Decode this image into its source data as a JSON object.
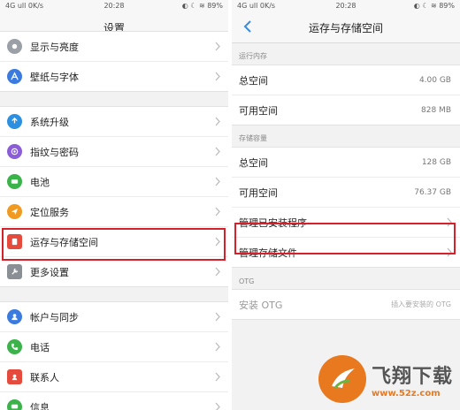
{
  "left": {
    "status": {
      "signal": "4G  ull  0K/s",
      "time": "20:28",
      "right": "◐ ☾ ≋ 89%"
    },
    "title": "设置",
    "groups": [
      {
        "items": [
          {
            "label": "显示与亮度",
            "icon": "sun-icon",
            "color": "#9aa0a6"
          },
          {
            "label": "壁纸与字体",
            "icon": "font-icon",
            "color": "#3b7be0"
          }
        ]
      },
      {
        "items": [
          {
            "label": "系统升级",
            "icon": "update-icon",
            "color": "#2d8fe0"
          },
          {
            "label": "指纹与密码",
            "icon": "fingerprint-icon",
            "color": "#8b5dd6"
          },
          {
            "label": "电池",
            "icon": "battery-icon",
            "color": "#3bb34a"
          },
          {
            "label": "定位服务",
            "icon": "location-icon",
            "color": "#f09a22"
          },
          {
            "label": "运存与存储空间",
            "icon": "storage-icon",
            "color": "#e44b3c"
          },
          {
            "label": "更多设置",
            "icon": "wrench-icon",
            "color": "#8a8f96"
          }
        ]
      },
      {
        "items": [
          {
            "label": "帐户与同步",
            "icon": "account-icon",
            "color": "#3b7be0"
          },
          {
            "label": "电话",
            "icon": "phone-icon",
            "color": "#3bb34a"
          },
          {
            "label": "联系人",
            "icon": "contacts-icon",
            "color": "#e44b3c"
          },
          {
            "label": "信息",
            "icon": "message-icon",
            "color": "#3bb34a"
          }
        ]
      }
    ]
  },
  "right": {
    "status": {
      "signal": "4G  ull  0K/s",
      "time": "20:28",
      "right": "◐ ☾ ≋ 89%"
    },
    "title": "运存与存储空间",
    "ram_header": "运行内存",
    "ram": [
      {
        "label": "总空间",
        "value": "4.00 GB"
      },
      {
        "label": "可用空间",
        "value": "828 MB"
      }
    ],
    "storage_header": "存储容量",
    "storage": [
      {
        "label": "总空间",
        "value": "128 GB"
      },
      {
        "label": "可用空间",
        "value": "76.37 GB"
      },
      {
        "label": "管理已安装程序",
        "value": ""
      },
      {
        "label": "管理存储文件",
        "value": ""
      }
    ],
    "otg_header": "OTG",
    "otg": {
      "label": "安装 OTG",
      "value": "插入要安装的 OTG"
    }
  },
  "watermark": {
    "title": "飞翔下载",
    "url": "www.52z.com"
  },
  "colors": {
    "highlight": "#d6202a",
    "accent": "#3b8be0"
  }
}
